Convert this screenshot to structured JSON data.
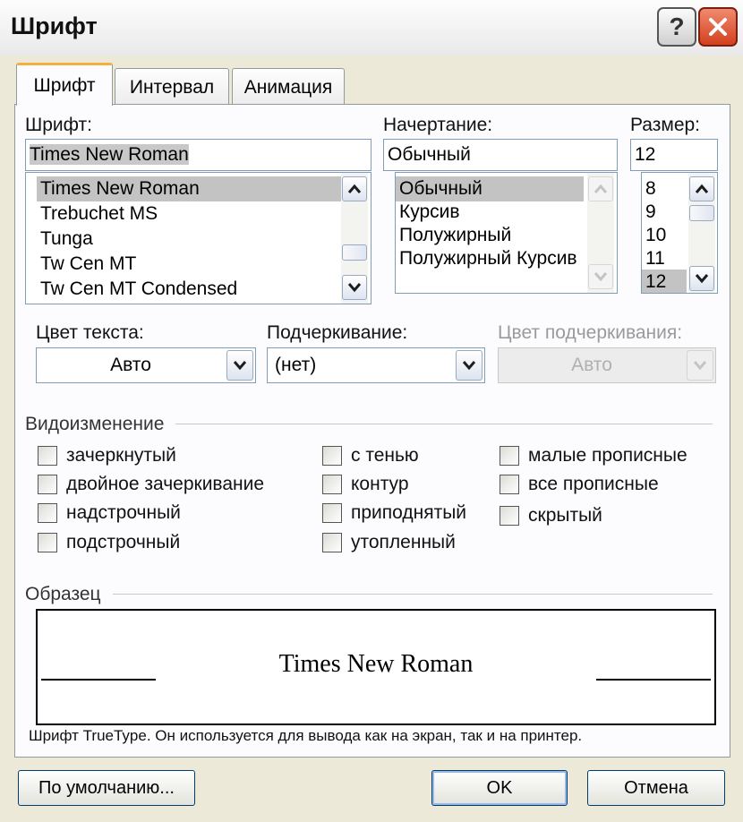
{
  "window": {
    "title": "Шрифт",
    "help_label": "?"
  },
  "tabs": [
    {
      "label": "Шрифт",
      "active": true
    },
    {
      "label": "Интервал",
      "active": false
    },
    {
      "label": "Анимация",
      "active": false
    }
  ],
  "font": {
    "label": "Шрифт:",
    "value": "Times New Roman",
    "options": [
      "Times New Roman",
      "Trebuchet MS",
      "Tunga",
      "Tw Cen MT",
      "Tw Cen MT Condensed"
    ],
    "selected_index": 0
  },
  "style": {
    "label": "Начертание:",
    "value": "Обычный",
    "options": [
      "Обычный",
      "Курсив",
      "Полужирный",
      "Полужирный Курсив"
    ],
    "selected_index": 0
  },
  "size": {
    "label": "Размер:",
    "value": "12",
    "options": [
      "8",
      "9",
      "10",
      "11",
      "12"
    ],
    "selected_index": 4
  },
  "text_color": {
    "label": "Цвет текста:",
    "value": "Авто"
  },
  "underline": {
    "label": "Подчеркивание:",
    "value": "(нет)"
  },
  "underline_color": {
    "label": "Цвет подчеркивания:",
    "value": "Авто"
  },
  "effects": {
    "title": "Видоизменение",
    "items": [
      {
        "label": "зачеркнутый",
        "checked": false
      },
      {
        "label": "двойное зачеркивание",
        "checked": false
      },
      {
        "label": "надстрочный",
        "checked": false
      },
      {
        "label": "подстрочный",
        "checked": false
      },
      {
        "label": "с тенью",
        "checked": false
      },
      {
        "label": "контур",
        "checked": false
      },
      {
        "label": "приподнятый",
        "checked": false
      },
      {
        "label": "утопленный",
        "checked": false
      },
      {
        "label": "малые прописные",
        "checked": false
      },
      {
        "label": "все прописные",
        "checked": false
      },
      {
        "label": "скрытый",
        "checked": false
      }
    ]
  },
  "preview": {
    "title": "Образец",
    "text": "Times New Roman",
    "note": "Шрифт TrueType. Он используется для вывода как на экран, так и на принтер."
  },
  "buttons": {
    "default_label": "По умолчанию...",
    "ok_label": "OK",
    "cancel_label": "Отмена"
  },
  "colors": {
    "title_bar": "#e9e9e9",
    "active_tab_accent": "#f4b23c",
    "selection": "#c3c3c3",
    "close_button": "#d2401e"
  }
}
